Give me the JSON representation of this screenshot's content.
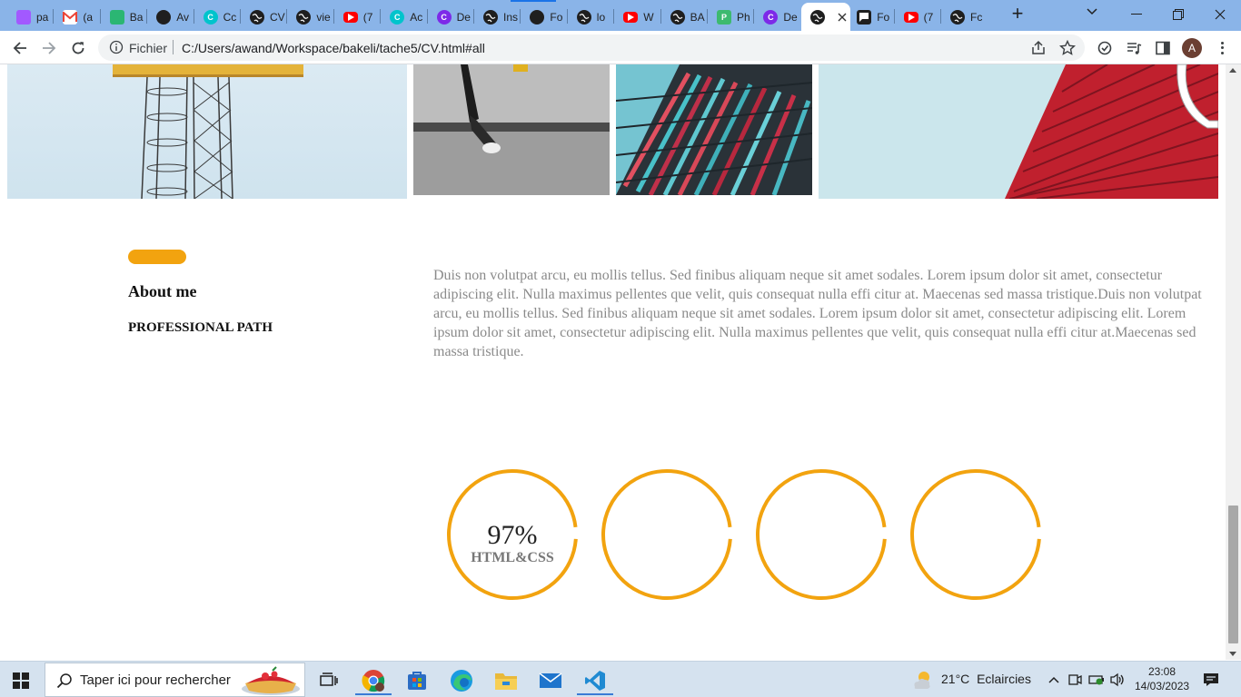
{
  "browser": {
    "tabs": [
      {
        "title": "pa",
        "icon": "figma-icon",
        "color": "#a259ff"
      },
      {
        "title": "(a",
        "icon": "gmail-icon",
        "color": "#ea4335"
      },
      {
        "title": "Ba",
        "icon": "chart-app-icon",
        "color": "#2bb673"
      },
      {
        "title": "Av",
        "icon": "github-icon",
        "color": "#1f1f1f"
      },
      {
        "title": "Cc",
        "icon": "canva-icon",
        "color": "#00c4cc"
      },
      {
        "title": "CV",
        "icon": "globe-icon",
        "color": "#1f1f1f"
      },
      {
        "title": "vie",
        "icon": "globe-icon",
        "color": "#1f1f1f"
      },
      {
        "title": "(7",
        "icon": "youtube-icon",
        "color": "#ff0000"
      },
      {
        "title": "Ac",
        "icon": "canva-icon",
        "color": "#00c4cc"
      },
      {
        "title": "De",
        "icon": "canva-icon",
        "color": "#7d2ae8"
      },
      {
        "title": "Ins",
        "icon": "globe-icon",
        "color": "#1f1f1f"
      },
      {
        "title": "Fo",
        "icon": "github-icon",
        "color": "#1f1f1f"
      },
      {
        "title": "lo",
        "icon": "globe-icon",
        "color": "#1f1f1f"
      },
      {
        "title": "W",
        "icon": "youtube-icon",
        "color": "#ff0000"
      },
      {
        "title": "BA",
        "icon": "globe-icon",
        "color": "#1f1f1f"
      },
      {
        "title": "Ph",
        "icon": "p-app-icon",
        "color": "#3dba6f"
      },
      {
        "title": "De",
        "icon": "canva-icon",
        "color": "#7d2ae8"
      },
      {
        "title": "",
        "icon": "globe-icon",
        "color": "#1f1f1f",
        "active": true
      },
      {
        "title": "Fo",
        "icon": "flag-icon",
        "color": "#1f1f1f"
      },
      {
        "title": "(7",
        "icon": "youtube-icon",
        "color": "#ff0000"
      },
      {
        "title": "Fc",
        "icon": "globe-icon",
        "color": "#1f1f1f"
      }
    ],
    "new_tab": "+",
    "scheme_label": "Fichier",
    "url": "C:/Users/awand/Workspace/bakeli/tache5/CV.html#all",
    "profile_initial": "A"
  },
  "page": {
    "about_title": "About me",
    "about_subtitle": "PROFESSIONAL PATH",
    "about_text": "Duis non volutpat arcu, eu mollis tellus. Sed finibus aliquam neque sit amet sodales. Lorem ipsum dolor sit amet, consectetur adipiscing elit. Nulla maximus pellentes que velit, quis consequat nulla effi citur at. Maecenas sed massa tristique.Duis non volutpat arcu, eu mollis tellus. Sed finibus aliquam neque sit amet sodales. Lorem ipsum dolor sit amet, consectetur adipiscing elit. Lorem ipsum dolor sit amet, consectetur adipiscing elit. Nulla maximus pellentes que velit, quis consequat nulla effi citur at.Maecenas sed massa tristique.",
    "skills": [
      {
        "value": "97%",
        "label": "HTML&CSS",
        "fraction": 0.97
      },
      {
        "value": "",
        "label": "",
        "fraction": 0.97
      },
      {
        "value": "",
        "label": "",
        "fraction": 0.97
      },
      {
        "value": "",
        "label": "",
        "fraction": 0.97
      }
    ],
    "accent_color": "#f2a30f"
  },
  "taskbar": {
    "search_placeholder": "Taper ici pour rechercher",
    "weather_temp": "21°C",
    "weather_desc": "Eclaircies",
    "time": "23:08",
    "date": "14/03/2023"
  }
}
